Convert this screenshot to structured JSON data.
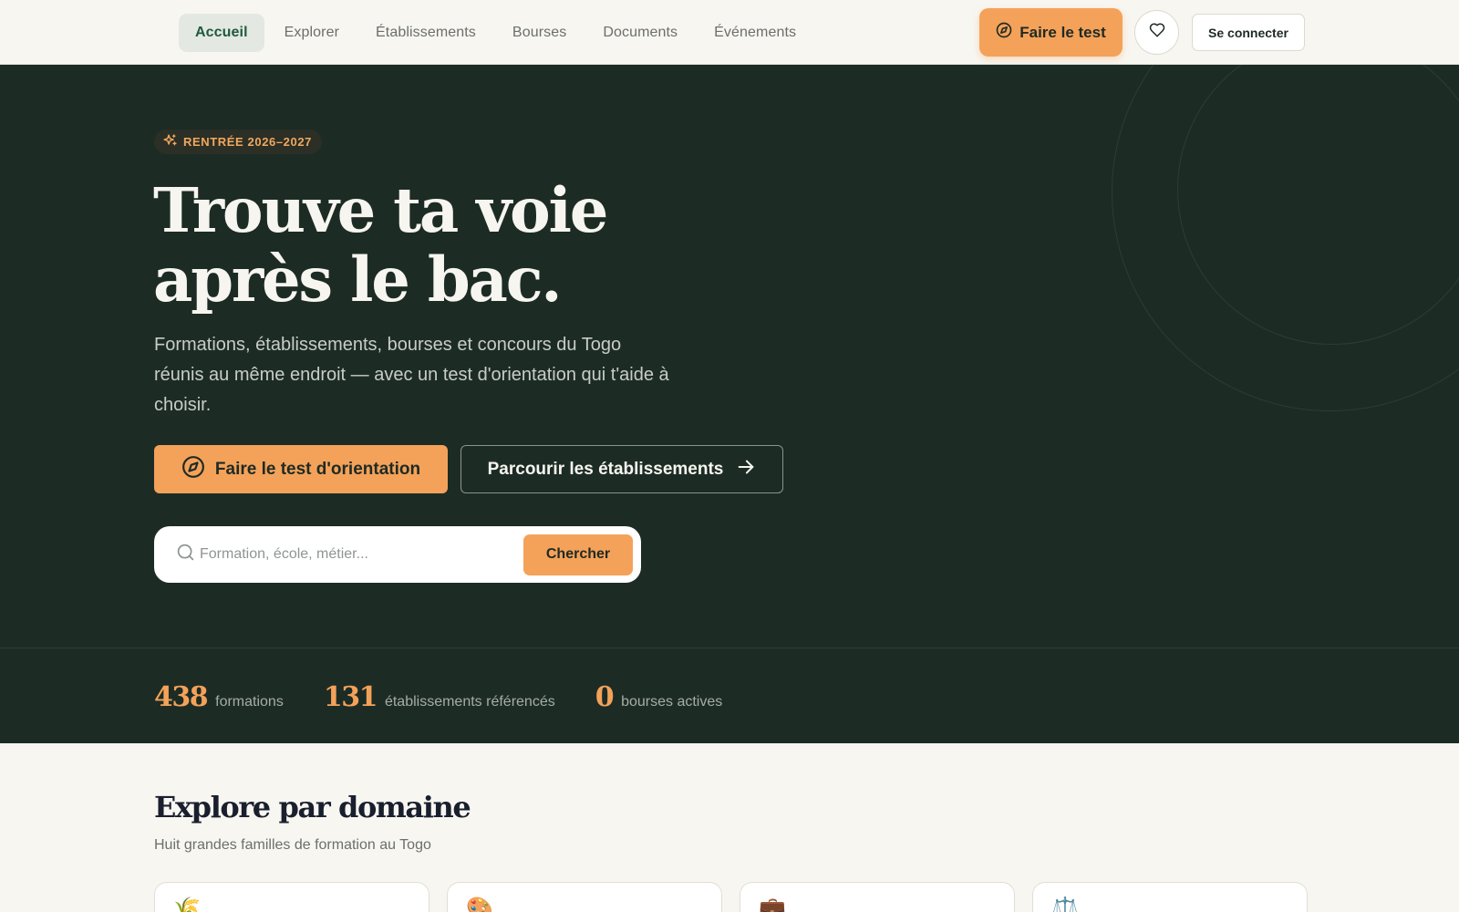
{
  "nav": {
    "items": [
      {
        "label": "Accueil",
        "active": true
      },
      {
        "label": "Explorer",
        "active": false
      },
      {
        "label": "Établissements",
        "active": false
      },
      {
        "label": "Bourses",
        "active": false
      },
      {
        "label": "Documents",
        "active": false
      },
      {
        "label": "Événements",
        "active": false
      }
    ],
    "test_label": "Faire le test",
    "favorites_icon": "heart-icon",
    "login_label": "Se connecter"
  },
  "hero": {
    "badge": "RENTRÉE 2026–2027",
    "title_line1": "Trouve ta voie",
    "title_line2": "après le bac.",
    "subtitle": "Formations, établissements, bourses et concours du Togo réunis au même endroit — avec un test d'orientation qui t'aide à choisir.",
    "cta_primary": "Faire le test d'orientation",
    "cta_secondary": "Parcourir les établissements",
    "search_placeholder": "Formation, école, métier...",
    "search_button": "Chercher"
  },
  "stats": [
    {
      "value": "438",
      "label": "formations"
    },
    {
      "value": "131",
      "label": "établissements référencés"
    },
    {
      "value": "0",
      "label": "bourses actives"
    }
  ],
  "domains": {
    "title": "Explore par domaine",
    "subtitle": "Huit grandes familles de formation au Togo",
    "cards": [
      {
        "icon": "🌾",
        "icon_name": "wheat-icon"
      },
      {
        "icon": "🎨",
        "icon_name": "palette-icon"
      },
      {
        "icon": "💼",
        "icon_name": "briefcase-icon"
      },
      {
        "icon": "⚖️",
        "icon_name": "scales-icon"
      }
    ]
  },
  "colors": {
    "accent": "#f4a259",
    "hero_bg": "#1c2c25",
    "page_bg": "#f8f6f1",
    "nav_active": "#1f5a3b"
  }
}
